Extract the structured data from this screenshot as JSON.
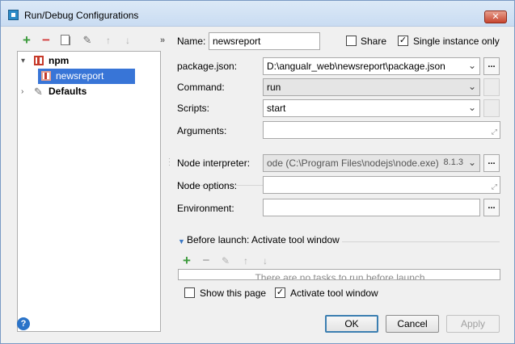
{
  "window": {
    "title": "Run/Debug Configurations",
    "close": "✕"
  },
  "toolbar": {
    "add": "+",
    "remove": "−",
    "up": "↑",
    "down": "↓",
    "more": "»"
  },
  "tree": {
    "npm": "npm",
    "newsreport": "newsreport",
    "defaults": "Defaults"
  },
  "form": {
    "name_label": "Name:",
    "name_value": "newsreport",
    "share_label": "Share",
    "single_instance_label": "Single instance only",
    "package_label": "package.json:",
    "package_value": "D:\\angualr_web\\newsreport\\package.json",
    "command_label": "Command:",
    "command_value": "run",
    "scripts_label": "Scripts:",
    "scripts_value": "start",
    "arguments_label": "Arguments:",
    "interpreter_label": "Node interpreter:",
    "interpreter_value": "ode (C:\\Program Files\\nodejs\\node.exe)",
    "interpreter_version": "8.1.3",
    "node_options_label": "Node options:",
    "environment_label": "Environment:",
    "ellipsis": "..."
  },
  "before_launch": {
    "label": "Before launch: Activate tool window",
    "empty_text": "There are no tasks to run before launch",
    "show_page_label": "Show this page",
    "activate_label": "Activate tool window"
  },
  "buttons": {
    "ok": "OK",
    "cancel": "Cancel",
    "apply": "Apply",
    "help": "?"
  },
  "checks": {
    "share": false,
    "single_instance": true,
    "show_page": false,
    "activate_tool_window": true
  }
}
